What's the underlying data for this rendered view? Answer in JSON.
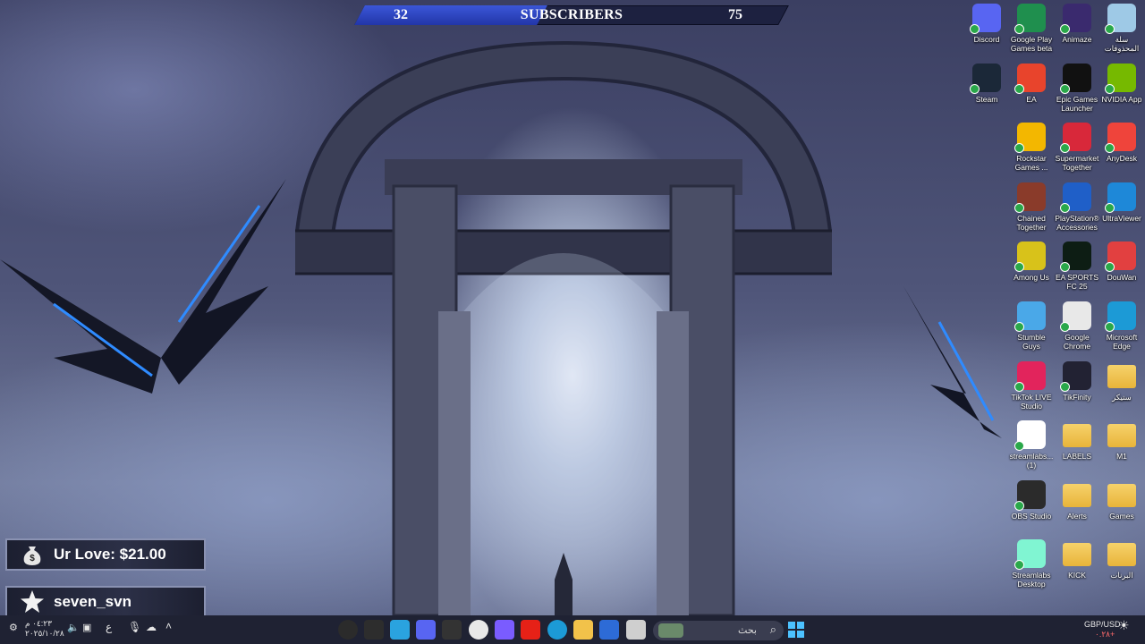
{
  "subscriber_bar": {
    "label": "SUBSCRIBERS",
    "current": "32",
    "goal": "75",
    "progress_fraction": 0.43
  },
  "overlays": {
    "donation": "Ur Love: $21.00",
    "latest_user": "seven_svn"
  },
  "desktop_icons": [
    {
      "label": "Discord",
      "icon": "discord-icon",
      "color": "#5865f2"
    },
    {
      "label": "Google Play Games beta",
      "icon": "google-play-games-icon",
      "color": "#1f8f4e"
    },
    {
      "label": "Animaze",
      "icon": "animaze-icon",
      "color": "#3a2a6e"
    },
    {
      "label": "سلة المحذوفات",
      "icon": "recycle-bin-icon",
      "color": "#9ec9e6"
    },
    {
      "label": "Steam",
      "icon": "steam-icon",
      "color": "#1b2838"
    },
    {
      "label": "EA",
      "icon": "ea-icon",
      "color": "#e8442c"
    },
    {
      "label": "Epic Games Launcher",
      "icon": "epic-games-icon",
      "color": "#111111"
    },
    {
      "label": "NVIDIA App",
      "icon": "nvidia-icon",
      "color": "#76b900"
    },
    {
      "label": "Rockstar Games ...",
      "icon": "rockstar-icon",
      "color": "#f3b700"
    },
    {
      "label": "Supermarket Together",
      "icon": "supermarket-together-icon",
      "color": "#d8283a"
    },
    {
      "label": "AnyDesk",
      "icon": "anydesk-icon",
      "color": "#ef443b"
    },
    {
      "label": "Chained Together",
      "icon": "chained-together-icon",
      "color": "#8a3b2a"
    },
    {
      "label": "PlayStation® Accessories",
      "icon": "playstation-icon",
      "color": "#1f5fc8"
    },
    {
      "label": "UltraViewer",
      "icon": "ultraviewer-icon",
      "color": "#1e88d8"
    },
    {
      "label": "Among Us",
      "icon": "among-us-icon",
      "color": "#d8c21a"
    },
    {
      "label": "EA SPORTS FC 25",
      "icon": "ea-sports-fc-icon",
      "color": "#0d1d14"
    },
    {
      "label": "DouWan",
      "icon": "douwan-icon",
      "color": "#e24040"
    },
    {
      "label": "Stumble Guys",
      "icon": "stumble-guys-icon",
      "color": "#4aa8e8"
    },
    {
      "label": "Google Chrome",
      "icon": "chrome-icon",
      "color": "#e8e8e8"
    },
    {
      "label": "Microsoft Edge",
      "icon": "edge-icon",
      "color": "#1c9ad6"
    },
    {
      "label": "TikTok LIVE Studio",
      "icon": "tiktok-live-icon",
      "color": "#e2245c"
    },
    {
      "label": "TikFinity",
      "icon": "tikfinity-icon",
      "color": "#222233"
    },
    {
      "label": "ستيكر",
      "icon": "folder-icon",
      "color": "#f0c550"
    },
    {
      "label": "streamlabs... (1)",
      "icon": "streamlabs-icon",
      "color": "#ffffff"
    },
    {
      "label": "LABELS",
      "icon": "folder-icon",
      "color": "#f0c550"
    },
    {
      "label": "M1",
      "icon": "folder-icon",
      "color": "#f0c550"
    },
    {
      "label": "OBS Studio",
      "icon": "obs-icon",
      "color": "#2b2b2b"
    },
    {
      "label": "Alerts",
      "icon": "folder-icon",
      "color": "#f0c550"
    },
    {
      "label": "Games",
      "icon": "folder-icon",
      "color": "#f0c550"
    },
    {
      "label": "Streamlabs Desktop",
      "icon": "streamlabs-desktop-icon",
      "color": "#80f5d2"
    },
    {
      "label": "KICK",
      "icon": "folder-icon",
      "color": "#f0c550"
    },
    {
      "label": "البرنات",
      "icon": "folder-icon",
      "color": "#f0c550"
    }
  ],
  "taskbar": {
    "search_placeholder": "بحث",
    "lang": "ع",
    "time": "٠٤:٢٣ م",
    "date": "٢٠٢٥/١٠/٢٨",
    "ticker_label": "GBP/USD",
    "ticker_value": "٠.٢٨+",
    "apps": [
      {
        "icon": "obs-icon",
        "color": "#2b2b2b"
      },
      {
        "icon": "streamlabs-icon",
        "color": "#2d2d2d"
      },
      {
        "icon": "telegram-icon",
        "color": "#2aa3df"
      },
      {
        "icon": "discord-icon",
        "color": "#5865f2"
      },
      {
        "icon": "battery-app-icon",
        "color": "#333333"
      },
      {
        "icon": "chrome-icon",
        "color": "#e8e8e8"
      },
      {
        "icon": "copilot-icon",
        "color": "#7a5cff"
      },
      {
        "icon": "youtube-icon",
        "color": "#e62117"
      },
      {
        "icon": "edge-icon",
        "color": "#1c9ad6"
      },
      {
        "icon": "file-explorer-icon",
        "color": "#f2c24a"
      },
      {
        "icon": "store-icon",
        "color": "#2d6bd6"
      },
      {
        "icon": "task-view-icon",
        "color": "#cfcfcf"
      }
    ]
  }
}
